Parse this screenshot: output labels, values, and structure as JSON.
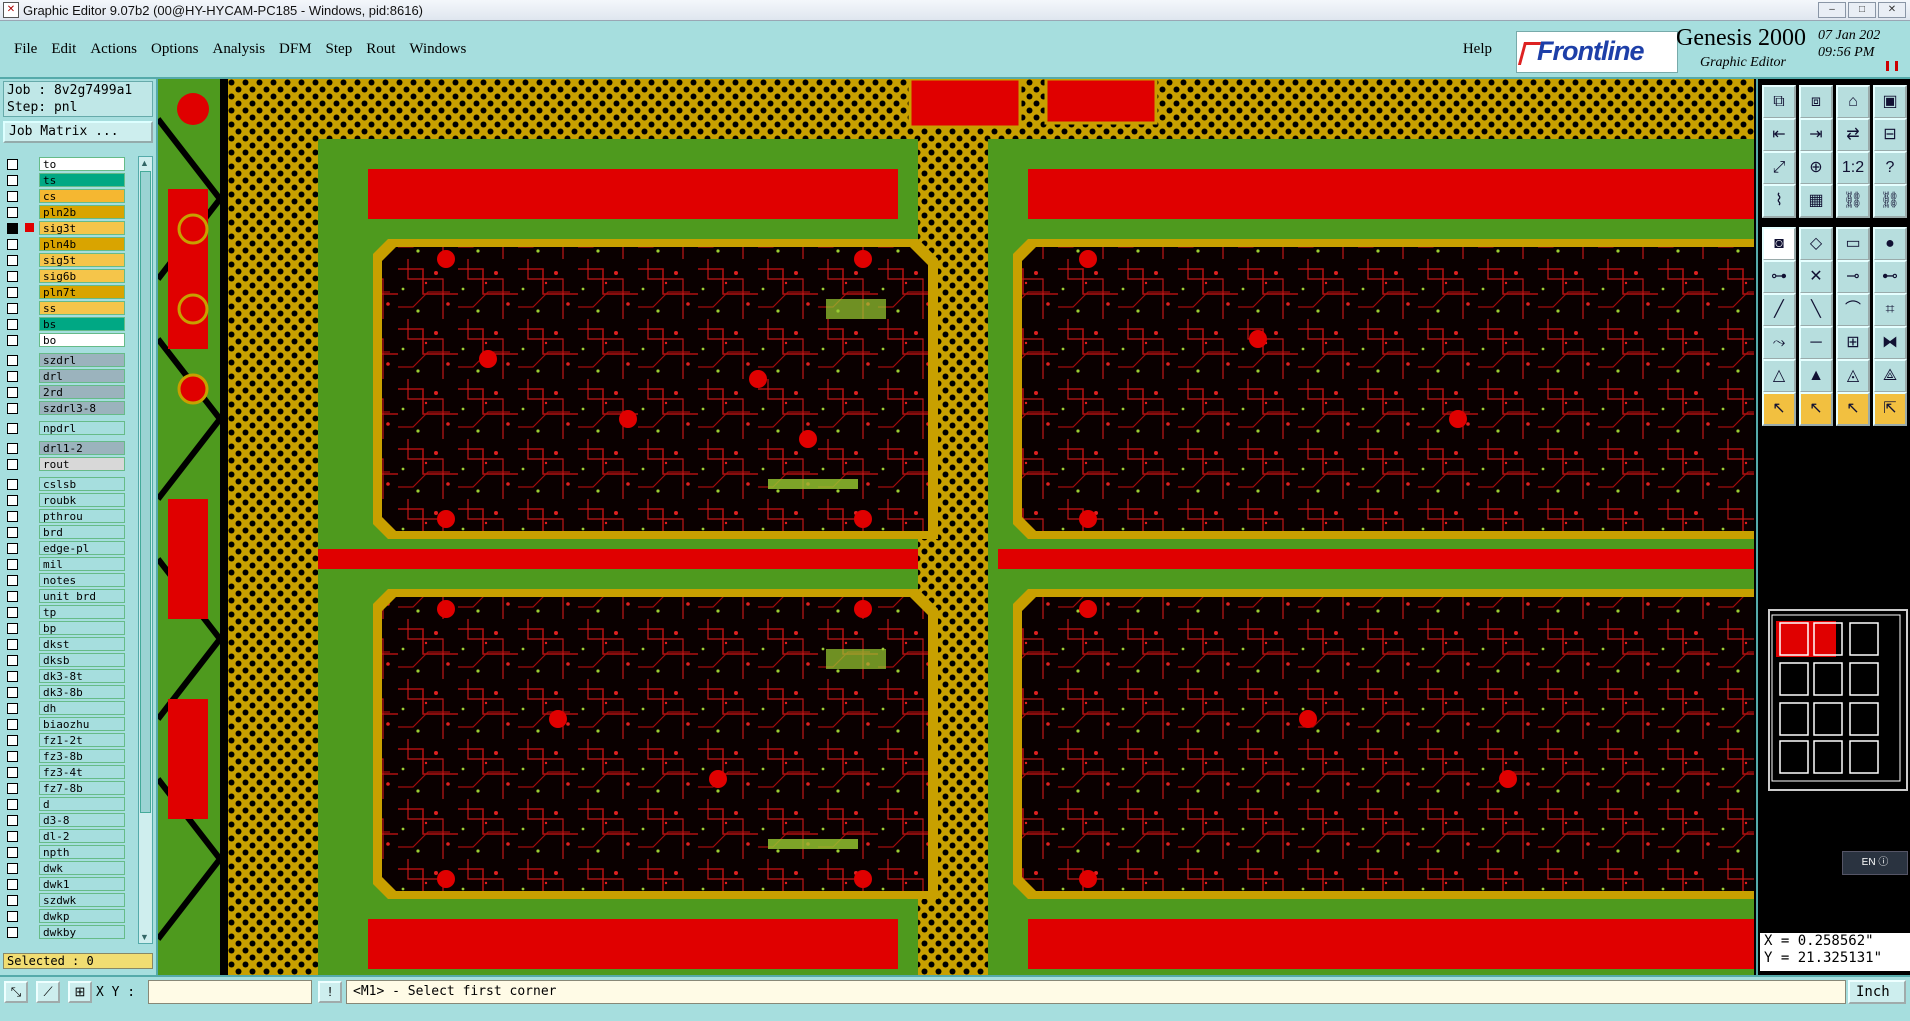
{
  "window": {
    "title": "Graphic Editor 9.07b2 (00@HY-HYCAM-PC185 - Windows, pid:8616)",
    "controls": [
      "–",
      "□",
      "✕"
    ]
  },
  "menu": {
    "items": [
      "File",
      "Edit",
      "Actions",
      "Options",
      "Analysis",
      "DFM",
      "Step",
      "Rout",
      "Windows"
    ],
    "help": "Help"
  },
  "brand": {
    "logo_text": "Frontline",
    "product": "Genesis 2000",
    "subtitle": "Graphic Editor",
    "date": "07 Jan 202",
    "time": "09:56 PM"
  },
  "job": {
    "job_line": "Job : 8v2g7499a1",
    "step_line": "Step: pnl",
    "matrix_button": "Job Matrix ..."
  },
  "layers": [
    {
      "name": "to",
      "color": "#ffffff",
      "swatch": "",
      "checked": false
    },
    {
      "name": "ts",
      "color": "#00a884",
      "swatch": "",
      "checked": false
    },
    {
      "name": "cs",
      "color": "#f5b731",
      "swatch": "",
      "checked": false
    },
    {
      "name": "pln2b",
      "color": "#d9a400",
      "swatch": "",
      "checked": false
    },
    {
      "name": "sig3t",
      "color": "#f5c54a",
      "swatch": "#e00000",
      "checked": true
    },
    {
      "name": "pln4b",
      "color": "#d9a400",
      "swatch": "",
      "checked": false
    },
    {
      "name": "sig5t",
      "color": "#f5c54a",
      "swatch": "",
      "checked": false
    },
    {
      "name": "sig6b",
      "color": "#f5c54a",
      "swatch": "",
      "checked": false
    },
    {
      "name": "pln7t",
      "color": "#d9a400",
      "swatch": "",
      "checked": false
    },
    {
      "name": "ss",
      "color": "#f5c54a",
      "swatch": "",
      "checked": false
    },
    {
      "name": "bs",
      "color": "#00a884",
      "swatch": "",
      "checked": false
    },
    {
      "name": "bo",
      "color": "#ffffff",
      "swatch": "",
      "checked": false
    },
    {
      "name": "szdrl",
      "color": "#9bb3bd",
      "swatch": "",
      "checked": false,
      "gap": true
    },
    {
      "name": "drl",
      "color": "#9bb3bd",
      "swatch": "",
      "checked": false
    },
    {
      "name": "2rd",
      "color": "#9bb3bd",
      "swatch": "",
      "checked": false
    },
    {
      "name": "szdrl3-8",
      "color": "#9bb3bd",
      "swatch": "",
      "checked": false
    },
    {
      "name": "npdrl",
      "color": "#a6dede",
      "swatch": "",
      "checked": false,
      "gap": true
    },
    {
      "name": "drl1-2",
      "color": "#9bb3bd",
      "swatch": "",
      "checked": false,
      "gap": true
    },
    {
      "name": "rout",
      "color": "#d8d8d8",
      "swatch": "",
      "checked": false
    },
    {
      "name": "cslsb",
      "color": "#a6dede",
      "swatch": "",
      "checked": false,
      "gap": true
    },
    {
      "name": "roubk",
      "color": "#a6dede",
      "swatch": "",
      "checked": false
    },
    {
      "name": "pthrou",
      "color": "#a6dede",
      "swatch": "",
      "checked": false
    },
    {
      "name": "brd",
      "color": "#a6dede",
      "swatch": "",
      "checked": false
    },
    {
      "name": "edge-pl",
      "color": "#a6dede",
      "swatch": "",
      "checked": false
    },
    {
      "name": "mil",
      "color": "#a6dede",
      "swatch": "",
      "checked": false
    },
    {
      "name": "notes",
      "color": "#a6dede",
      "swatch": "",
      "checked": false
    },
    {
      "name": "unit_brd",
      "color": "#a6dede",
      "swatch": "",
      "checked": false
    },
    {
      "name": "tp",
      "color": "#a6dede",
      "swatch": "",
      "checked": false
    },
    {
      "name": "bp",
      "color": "#a6dede",
      "swatch": "",
      "checked": false
    },
    {
      "name": "dkst",
      "color": "#a6dede",
      "swatch": "",
      "checked": false
    },
    {
      "name": "dksb",
      "color": "#a6dede",
      "swatch": "",
      "checked": false
    },
    {
      "name": "dk3-8t",
      "color": "#a6dede",
      "swatch": "",
      "checked": false
    },
    {
      "name": "dk3-8b",
      "color": "#a6dede",
      "swatch": "",
      "checked": false
    },
    {
      "name": "dh",
      "color": "#a6dede",
      "swatch": "",
      "checked": false
    },
    {
      "name": "biaozhu",
      "color": "#a6dede",
      "swatch": "",
      "checked": false
    },
    {
      "name": "fz1-2t",
      "color": "#a6dede",
      "swatch": "",
      "checked": false
    },
    {
      "name": "fz3-8b",
      "color": "#a6dede",
      "swatch": "",
      "checked": false
    },
    {
      "name": "fz3-4t",
      "color": "#a6dede",
      "swatch": "",
      "checked": false
    },
    {
      "name": "fz7-8b",
      "color": "#a6dede",
      "swatch": "",
      "checked": false
    },
    {
      "name": "d",
      "color": "#a6dede",
      "swatch": "",
      "checked": false
    },
    {
      "name": "d3-8",
      "color": "#a6dede",
      "swatch": "",
      "checked": false
    },
    {
      "name": "dl-2",
      "color": "#a6dede",
      "swatch": "",
      "checked": false
    },
    {
      "name": "npth",
      "color": "#a6dede",
      "swatch": "",
      "checked": false
    },
    {
      "name": "dwk",
      "color": "#a6dede",
      "swatch": "",
      "checked": false
    },
    {
      "name": "dwk1",
      "color": "#a6dede",
      "swatch": "",
      "checked": false
    },
    {
      "name": "szdwk",
      "color": "#a6dede",
      "swatch": "",
      "checked": false
    },
    {
      "name": "dwkp",
      "color": "#a6dede",
      "swatch": "",
      "checked": false
    },
    {
      "name": "dwkby",
      "color": "#a6dede",
      "swatch": "",
      "checked": false
    }
  ],
  "selected": "Selected : 0",
  "tools": [
    {
      "icon": "copy-layer-icon",
      "glyph": "⧉"
    },
    {
      "icon": "paste-layer-icon",
      "glyph": "⧈"
    },
    {
      "icon": "home-icon",
      "glyph": "⌂"
    },
    {
      "icon": "window-icon",
      "glyph": "▣"
    },
    {
      "icon": "move-left-icon",
      "glyph": "⇤"
    },
    {
      "icon": "move-right-icon",
      "glyph": "⇥"
    },
    {
      "icon": "swap-icon",
      "glyph": "⇄"
    },
    {
      "icon": "split-icon",
      "glyph": "⊟"
    },
    {
      "icon": "zoom-fit-icon",
      "glyph": "⤢"
    },
    {
      "icon": "zoom-area-icon",
      "glyph": "⊕"
    },
    {
      "icon": "scale-one-icon",
      "glyph": "1:2"
    },
    {
      "icon": "question-icon",
      "glyph": "?"
    },
    {
      "icon": "wire-icon",
      "glyph": "⌇"
    },
    {
      "icon": "grid-icon",
      "glyph": "▦"
    },
    {
      "icon": "net-icon",
      "glyph": "⛓"
    },
    {
      "icon": "net2-icon",
      "glyph": "⛓"
    },
    {
      "icon": "pad-icon",
      "glyph": "◙"
    },
    {
      "icon": "shape-icon",
      "glyph": "◇"
    },
    {
      "icon": "ruler-icon",
      "glyph": "▭"
    },
    {
      "icon": "dot-icon",
      "glyph": "●"
    },
    {
      "icon": "node-icon",
      "glyph": "⊶"
    },
    {
      "icon": "cross-icon",
      "glyph": "✕"
    },
    {
      "icon": "connect-icon",
      "glyph": "⊸"
    },
    {
      "icon": "link-icon",
      "glyph": "⊷"
    },
    {
      "icon": "line-icon",
      "glyph": "╱"
    },
    {
      "icon": "line2-icon",
      "glyph": "╲"
    },
    {
      "icon": "arc-icon",
      "glyph": "⌒"
    },
    {
      "icon": "frame-icon",
      "glyph": "⌗"
    },
    {
      "icon": "route-icon",
      "glyph": "⤳"
    },
    {
      "icon": "minus-icon",
      "glyph": "─"
    },
    {
      "icon": "measure-icon",
      "glyph": "⊞"
    },
    {
      "icon": "group-icon",
      "glyph": "⧓"
    },
    {
      "icon": "triangle-icon",
      "glyph": "△"
    },
    {
      "icon": "triangle2-icon",
      "glyph": "▲"
    },
    {
      "icon": "triangle3-icon",
      "glyph": "◬"
    },
    {
      "icon": "triangle4-icon",
      "glyph": "⟁"
    },
    {
      "icon": "pointer-icon",
      "glyph": "↖"
    },
    {
      "icon": "pointer-select-icon",
      "glyph": "↖"
    },
    {
      "icon": "pointer-edit-icon",
      "glyph": "↖"
    },
    {
      "icon": "pointer-multi-icon",
      "glyph": "⇱"
    }
  ],
  "coords": {
    "x": "X = 0.258562\"",
    "y": "Y = 21.325131\""
  },
  "status": {
    "xy_label": "X Y :",
    "xy_value": "",
    "prompt": "<M1> - Select first corner",
    "unit": "Inch",
    "info_icon": "!"
  },
  "ime_badge": "EN"
}
